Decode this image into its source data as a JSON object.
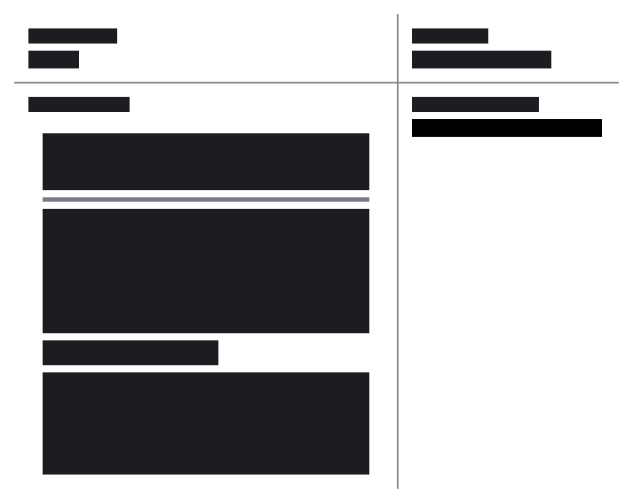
{
  "colors": {
    "block": "#1c1d21",
    "block_deep": "#000000",
    "divider": "#8a8a8f",
    "separator_bar": "#7b7b86",
    "background": "#ffffff"
  }
}
